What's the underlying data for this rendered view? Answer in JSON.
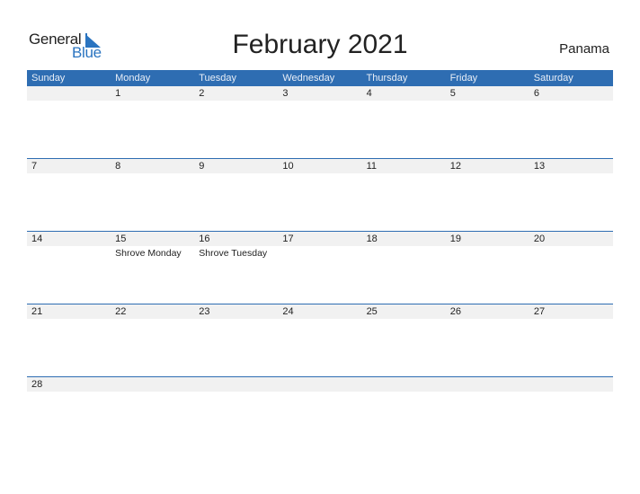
{
  "logo": {
    "word1": "General",
    "word2": "Blue"
  },
  "title": "February 2021",
  "country": "Panama",
  "colors": {
    "header": "#2e6db2",
    "accent": "#2a74c0",
    "strip": "#f1f1f1"
  },
  "weekdays": [
    "Sunday",
    "Monday",
    "Tuesday",
    "Wednesday",
    "Thursday",
    "Friday",
    "Saturday"
  ],
  "weeks": [
    [
      {
        "day": ""
      },
      {
        "day": "1"
      },
      {
        "day": "2"
      },
      {
        "day": "3"
      },
      {
        "day": "4"
      },
      {
        "day": "5"
      },
      {
        "day": "6"
      }
    ],
    [
      {
        "day": "7"
      },
      {
        "day": "8"
      },
      {
        "day": "9"
      },
      {
        "day": "10"
      },
      {
        "day": "11"
      },
      {
        "day": "12"
      },
      {
        "day": "13"
      }
    ],
    [
      {
        "day": "14"
      },
      {
        "day": "15",
        "holiday": "Shrove Monday"
      },
      {
        "day": "16",
        "holiday": "Shrove Tuesday"
      },
      {
        "day": "17"
      },
      {
        "day": "18"
      },
      {
        "day": "19"
      },
      {
        "day": "20"
      }
    ],
    [
      {
        "day": "21"
      },
      {
        "day": "22"
      },
      {
        "day": "23"
      },
      {
        "day": "24"
      },
      {
        "day": "25"
      },
      {
        "day": "26"
      },
      {
        "day": "27"
      }
    ],
    [
      {
        "day": "28"
      }
    ]
  ]
}
